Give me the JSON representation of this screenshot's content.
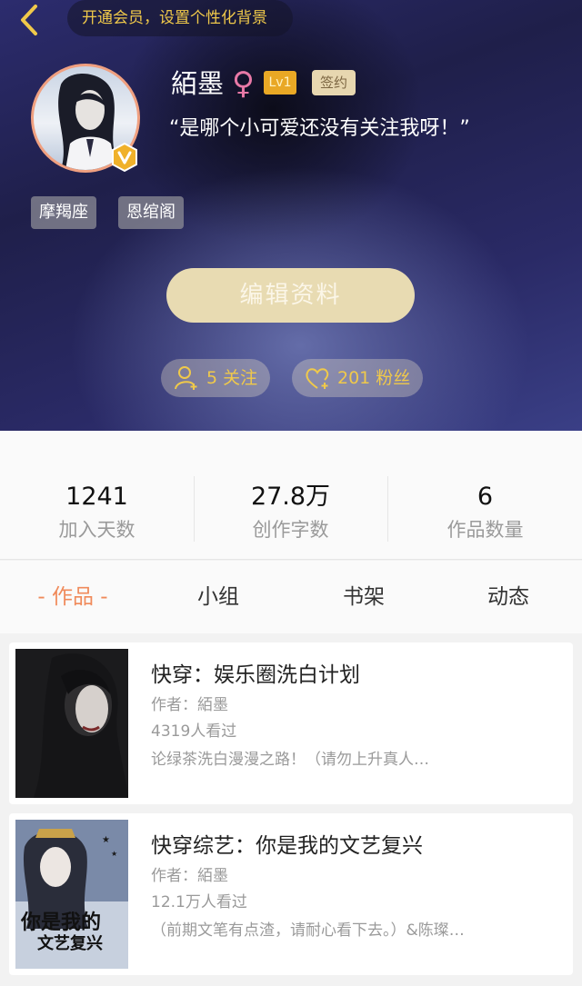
{
  "header": {
    "vip_banner": "开通会员，设置个性化背景",
    "username": "絔墨",
    "gender_symbol": "♀",
    "level": "Lv1",
    "signed": "签约",
    "motto": "“是哪个小可爱还没有关注我呀！”",
    "tags": [
      "摩羯座",
      "恩绾阁"
    ],
    "edit_button": "编辑资料",
    "following": "5 关注",
    "fans": "201 粉丝"
  },
  "stats": [
    {
      "value": "1241",
      "label": "加入天数"
    },
    {
      "value": "27.8万",
      "label": "创作字数"
    },
    {
      "value": "6",
      "label": "作品数量"
    }
  ],
  "tabs": [
    "- 作品 -",
    "小组",
    "书架",
    "动态"
  ],
  "books": [
    {
      "title": "快穿：娱乐圈洗白计划",
      "author": "作者：絔墨",
      "views": "4319人看过",
      "summary": "论绿茶洗白漫漫之路！（请勿上升真人…"
    },
    {
      "title": "快穿综艺：你是我的文艺复兴",
      "author": "作者：絔墨",
      "views": "12.1万人看过",
      "summary": "（前期文笔有点渣，请耐心看下去。）&陈璨…",
      "cover_text": [
        "你是我的",
        "文艺复兴"
      ]
    }
  ],
  "colors": {
    "accent_orange": "#f08a5a",
    "gold": "#f0c94a",
    "edit_button_bg": "#e8dbb2"
  }
}
